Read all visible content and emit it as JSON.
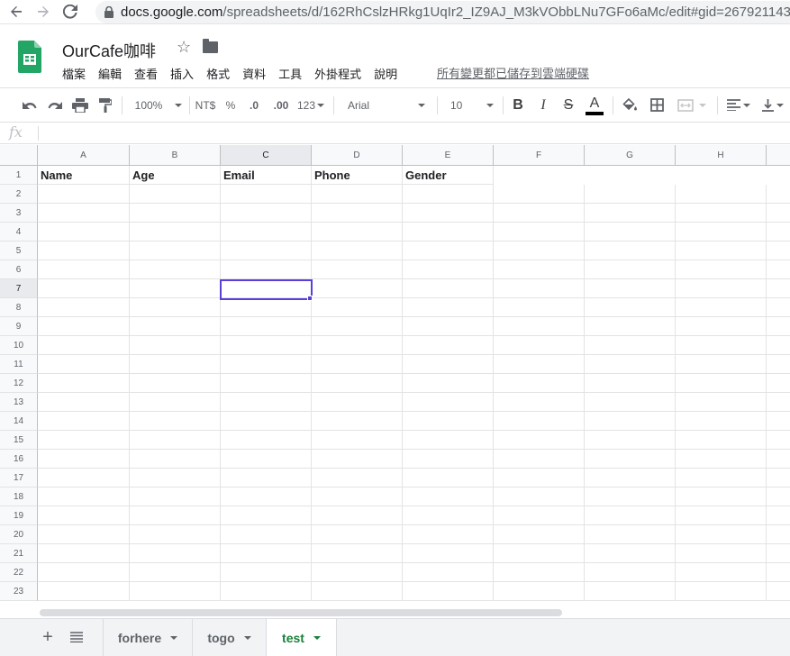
{
  "browser": {
    "url_domain": "docs.google.com",
    "url_path": "/spreadsheets/d/162RhCslzHRkg1UqIr2_IZ9AJ_M3kVObbLNu7GFo6aMc/edit#gid=267921143"
  },
  "doc": {
    "title": "OurCafe咖啡",
    "menu": [
      "檔案",
      "編輯",
      "查看",
      "插入",
      "格式",
      "資料",
      "工具",
      "外掛程式",
      "說明"
    ],
    "save_status": "所有變更都已儲存到雲端硬碟"
  },
  "toolbar": {
    "zoom": "100%",
    "currency": "NT$",
    "percent": "%",
    "decrease_decimal": ".0",
    "increase_decimal": ".00",
    "more_formats": "123",
    "font": "Arial",
    "font_size": "10",
    "bold": "B",
    "italic": "I",
    "strike": "S",
    "text_color": "A"
  },
  "formula_bar": {
    "fx": "fx",
    "value": ""
  },
  "grid": {
    "columns": [
      "A",
      "B",
      "C",
      "D",
      "E",
      "F",
      "G",
      "H"
    ],
    "rows": [
      "1",
      "2",
      "3",
      "4",
      "5",
      "6",
      "7",
      "8",
      "9",
      "10",
      "11",
      "12",
      "13",
      "14",
      "15",
      "16",
      "17",
      "18",
      "19",
      "20",
      "21",
      "22",
      "23"
    ],
    "headers": [
      "Name",
      "Age",
      "Email",
      "Phone",
      "Gender"
    ],
    "selected_cell": "C7"
  },
  "sheets": {
    "tabs": [
      {
        "label": "forhere",
        "active": false
      },
      {
        "label": "togo",
        "active": false
      },
      {
        "label": "test",
        "active": true
      }
    ]
  },
  "colors": {
    "accent_green": "#188038",
    "selection": "#5b3fd8"
  }
}
